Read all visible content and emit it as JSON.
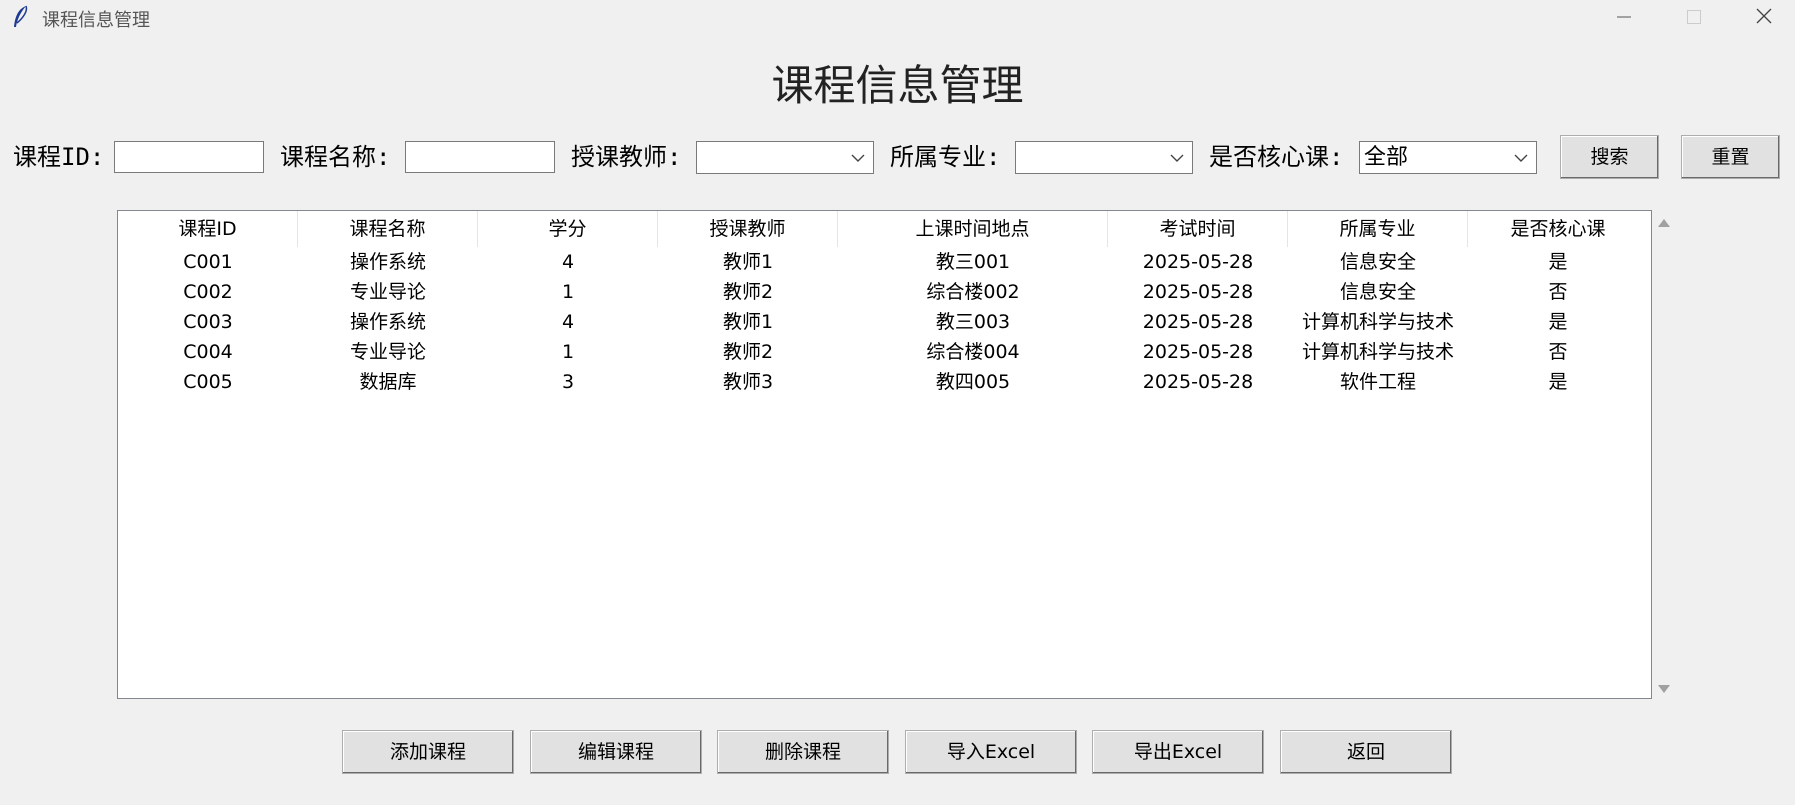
{
  "window": {
    "title": "课程信息管理"
  },
  "heading": "课程信息管理",
  "search": {
    "course_id_label": "课程ID:",
    "course_id_value": "",
    "course_name_label": "课程名称:",
    "course_name_value": "",
    "teacher_label": "授课教师:",
    "teacher_value": "",
    "major_label": "所属专业:",
    "major_value": "",
    "core_label": "是否核心课:",
    "core_value": "全部",
    "search_button": "搜索",
    "reset_button": "重置"
  },
  "table": {
    "columns": [
      "课程ID",
      "课程名称",
      "学分",
      "授课教师",
      "上课时间地点",
      "考试时间",
      "所属专业",
      "是否核心课"
    ],
    "rows": [
      [
        "C001",
        "操作系统",
        "4",
        "教师1",
        "教三001",
        "2025-05-28",
        "信息安全",
        "是"
      ],
      [
        "C002",
        "专业导论",
        "1",
        "教师2",
        "综合楼002",
        "2025-05-28",
        "信息安全",
        "否"
      ],
      [
        "C003",
        "操作系统",
        "4",
        "教师1",
        "教三003",
        "2025-05-28",
        "计算机科学与技术",
        "是"
      ],
      [
        "C004",
        "专业导论",
        "1",
        "教师2",
        "综合楼004",
        "2025-05-28",
        "计算机科学与技术",
        "否"
      ],
      [
        "C005",
        "数据库",
        "3",
        "教师3",
        "教四005",
        "2025-05-28",
        "软件工程",
        "是"
      ]
    ]
  },
  "actions": {
    "add": "添加课程",
    "edit": "编辑课程",
    "delete": "删除课程",
    "import": "导入Excel",
    "export": "导出Excel",
    "back": "返回"
  },
  "icons": {
    "app": "feather-icon",
    "minimize": "minimize-icon",
    "maximize": "maximize-icon",
    "close": "close-icon",
    "dropdown": "chevron-down-icon"
  }
}
